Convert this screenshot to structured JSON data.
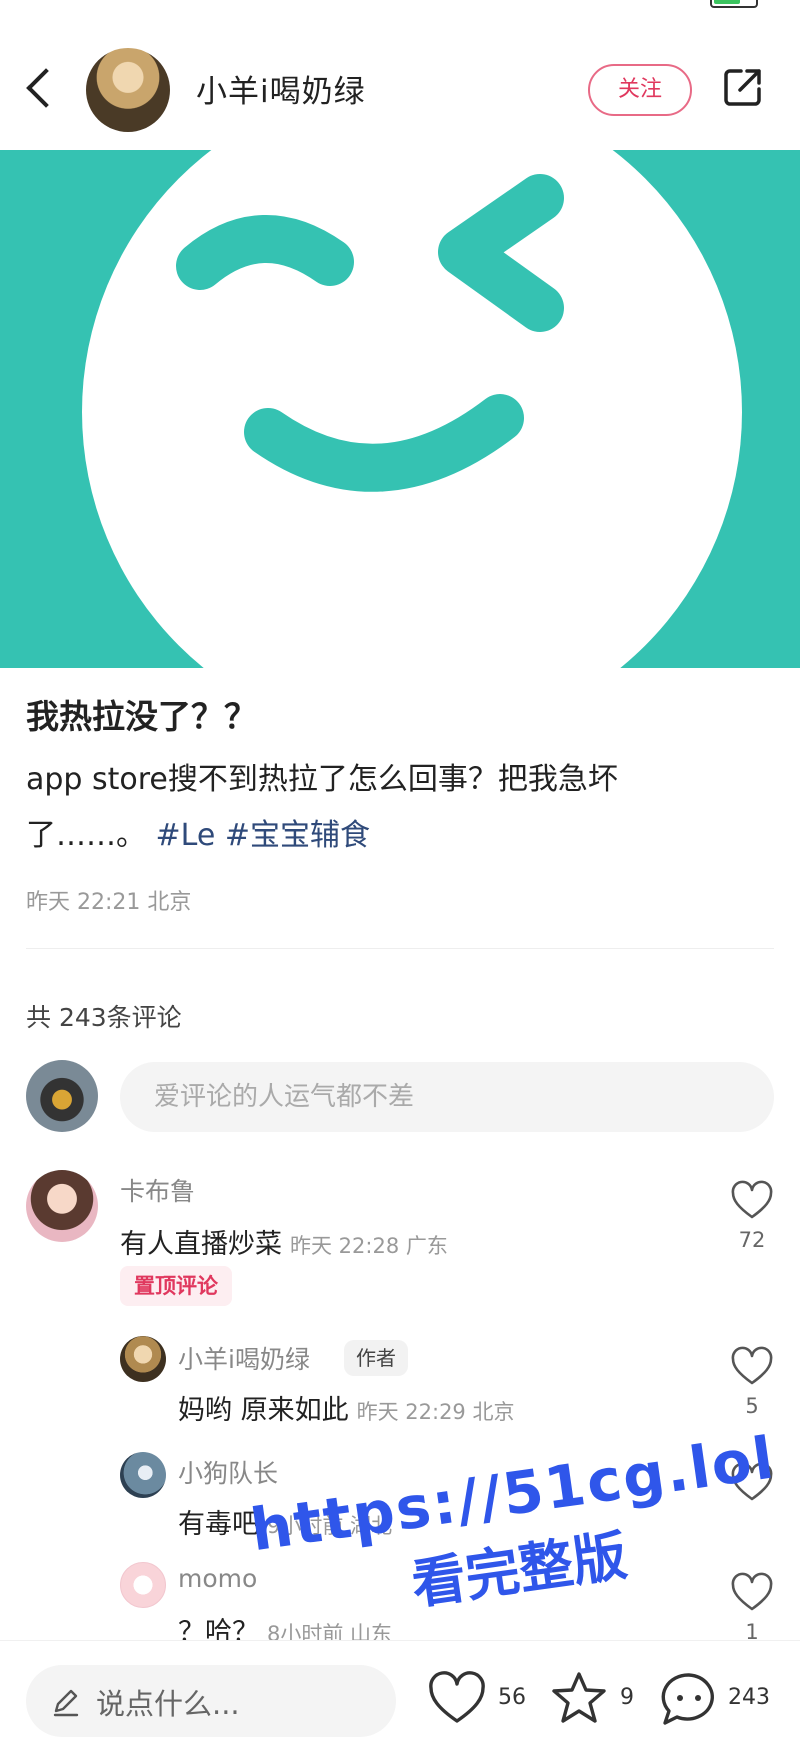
{
  "header": {
    "author_name": "小羊i喝奶绿",
    "follow_label": "关注"
  },
  "post": {
    "title": "我热拉没了？？",
    "body_line1": "app store搜不到热拉了怎么回事？把我急坏",
    "body_line2_prefix": "了……。",
    "tags": [
      "#Le",
      "#宝宝辅食"
    ],
    "meta": "昨天 22:21 北京"
  },
  "comments_section": {
    "count_label": "共 243条评论",
    "input_placeholder": "爱评论的人运气都不差",
    "comments": [
      {
        "name": "卡布鲁",
        "text": "有人直播炒菜",
        "time": "昨天 22:28 广东",
        "likes": "72",
        "badge": "置顶评论"
      },
      {
        "name": "小羊i喝奶绿",
        "badge": "作者",
        "text": "妈哟 原来如此",
        "time": "昨天 22:29 北京",
        "likes": "5"
      },
      {
        "name": "小狗队长",
        "text": "有毒吧",
        "time": "9小时前 湖北",
        "likes": ""
      },
      {
        "name": "momo",
        "text": "？哈？",
        "time": "8小时前 山东",
        "likes": "1"
      }
    ]
  },
  "watermark": {
    "line1": "https://51cg.lol",
    "line2": "看完整版"
  },
  "bottom_bar": {
    "input_placeholder": "说点什么...",
    "likes": "56",
    "favorites": "9",
    "comments": "243"
  },
  "colors": {
    "accent": "#e0385e",
    "banner": "#35c2b2",
    "tag": "#2f4a7a",
    "watermark": "#2f56ea"
  }
}
